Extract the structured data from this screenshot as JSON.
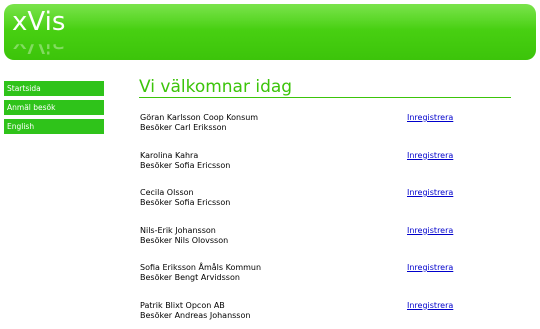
{
  "header": {
    "logo_text": "xVis"
  },
  "nav": {
    "items": [
      {
        "label": "Startsida"
      },
      {
        "label": "Anmäl besök"
      },
      {
        "label": "English"
      }
    ]
  },
  "main": {
    "title": "Vi välkomnar idag",
    "visits": [
      {
        "visitor": "Göran Karlsson Coop Konsum",
        "host": "Besöker Carl Eriksson",
        "action": "Inregistrera"
      },
      {
        "visitor": "Karolina Kahra",
        "host": "Besöker Sofia Ericsson",
        "action": "Inregistrera"
      },
      {
        "visitor": "Cecila Olsson",
        "host": "Besöker Sofia Ericsson",
        "action": "Inregistrera"
      },
      {
        "visitor": "Nils-Erik Johansson",
        "host": "Besöker Nils Olovsson",
        "action": "Inregistrera"
      },
      {
        "visitor": "Sofia Eriksson Åmåls Kommun",
        "host": "Besöker Bengt Arvidsson",
        "action": "Inregistrera"
      },
      {
        "visitor": "Patrik Blixt Opcon AB",
        "host": "Besöker Andreas Johansson",
        "action": "Inregistrera"
      }
    ]
  }
}
